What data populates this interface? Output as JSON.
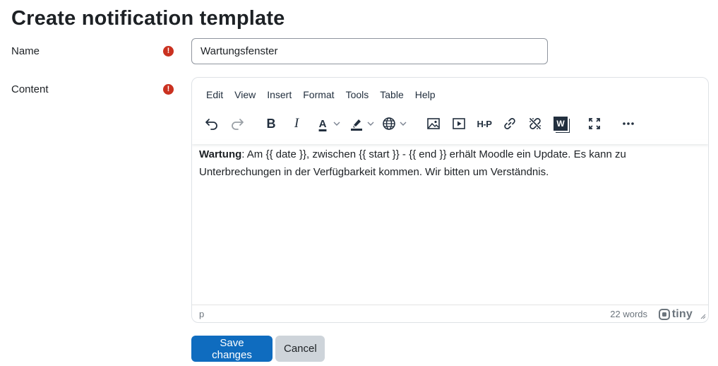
{
  "page": {
    "title": "Create notification template"
  },
  "form": {
    "name_label": "Name",
    "name_value": "Wartungsfenster",
    "content_label": "Content",
    "required_icon": "exclamation-circle-icon",
    "required_glyph": "!"
  },
  "editor": {
    "menus": [
      "Edit",
      "View",
      "Insert",
      "Format",
      "Tools",
      "Table",
      "Help"
    ],
    "toolbar": {
      "bold": "B",
      "italic": "I",
      "text_color": "A",
      "h5p": "H-P",
      "word": "W"
    },
    "content": {
      "bold_text": "Wartung",
      "text": ": Am {{ date }}, zwischen {{ start }} - {{ end }} erhält Moodle ein Update. Es kann zu Unterbrechungen in der Verfügbarkeit kommen. Wir bitten um Verständnis."
    },
    "status": {
      "path": "p",
      "word_count": "22 words",
      "brand": "tiny"
    }
  },
  "buttons": {
    "save": "Save changes",
    "cancel": "Cancel"
  },
  "colors": {
    "primary": "#0f6cbf",
    "required": "#ca3120",
    "secondary": "#ced4da"
  }
}
